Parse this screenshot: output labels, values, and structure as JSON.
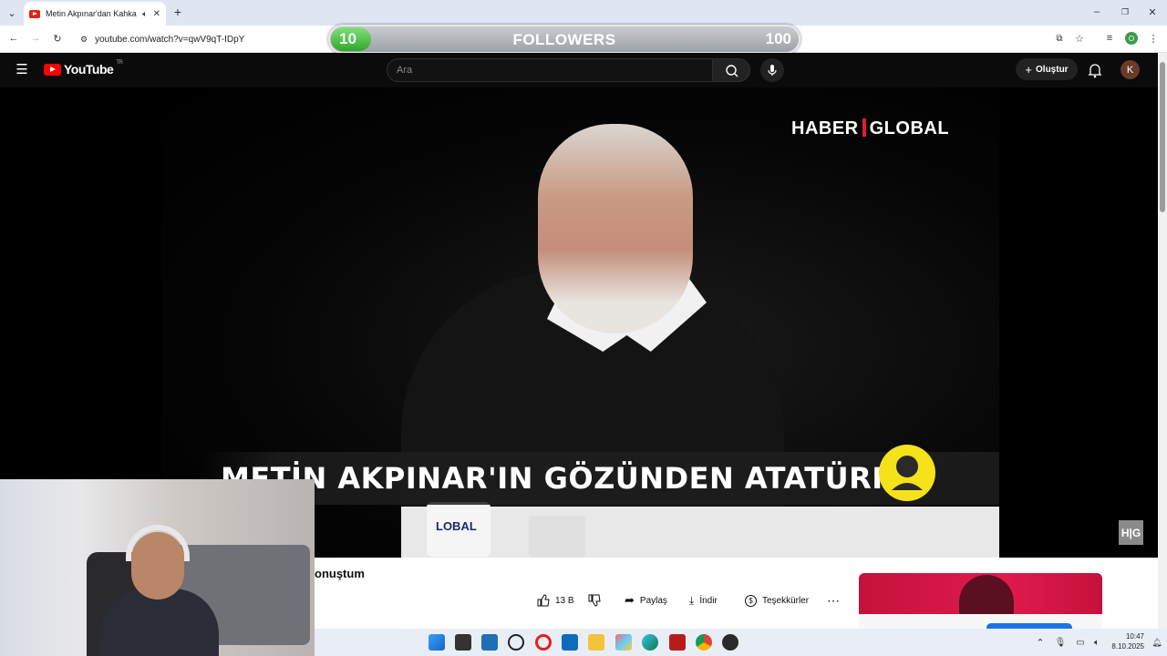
{
  "browser": {
    "tab_title": "Metin Akpınar'dan Kahkaha",
    "url": "youtube.com/watch?v=qwV9qT-IDpY",
    "profile_initial": "O"
  },
  "followers_overlay": {
    "current": "10",
    "label": "FOLLOWERS",
    "goal": "100",
    "progress_fraction": 0.1
  },
  "youtube": {
    "logo_text": "YouTube",
    "region": "TR",
    "search_placeholder": "Ara",
    "create_label": "Oluştur",
    "avatar_initial": "K"
  },
  "video": {
    "channel_logo_left": "HABER",
    "channel_logo_right": "GLOBAL",
    "headline": "METİN AKPINAR'IN GÖZÜNDEN ATATÜRK",
    "cup_text": "LOBAL",
    "corner_logo": "H|G"
  },
  "below_video": {
    "title_fragment": "onuştum",
    "like_count": "13 B",
    "share_label": "Paylaş",
    "download_label": "İndir",
    "thanks_label": "Teşekkürler",
    "more_label": "⋯"
  },
  "taskbar": {
    "time": "10:47",
    "date": "8.10.2025"
  },
  "colors": {
    "youtube_red": "#ff0000",
    "followers_fill": "#2fa82b",
    "haber_global_red": "#e01e2a"
  }
}
